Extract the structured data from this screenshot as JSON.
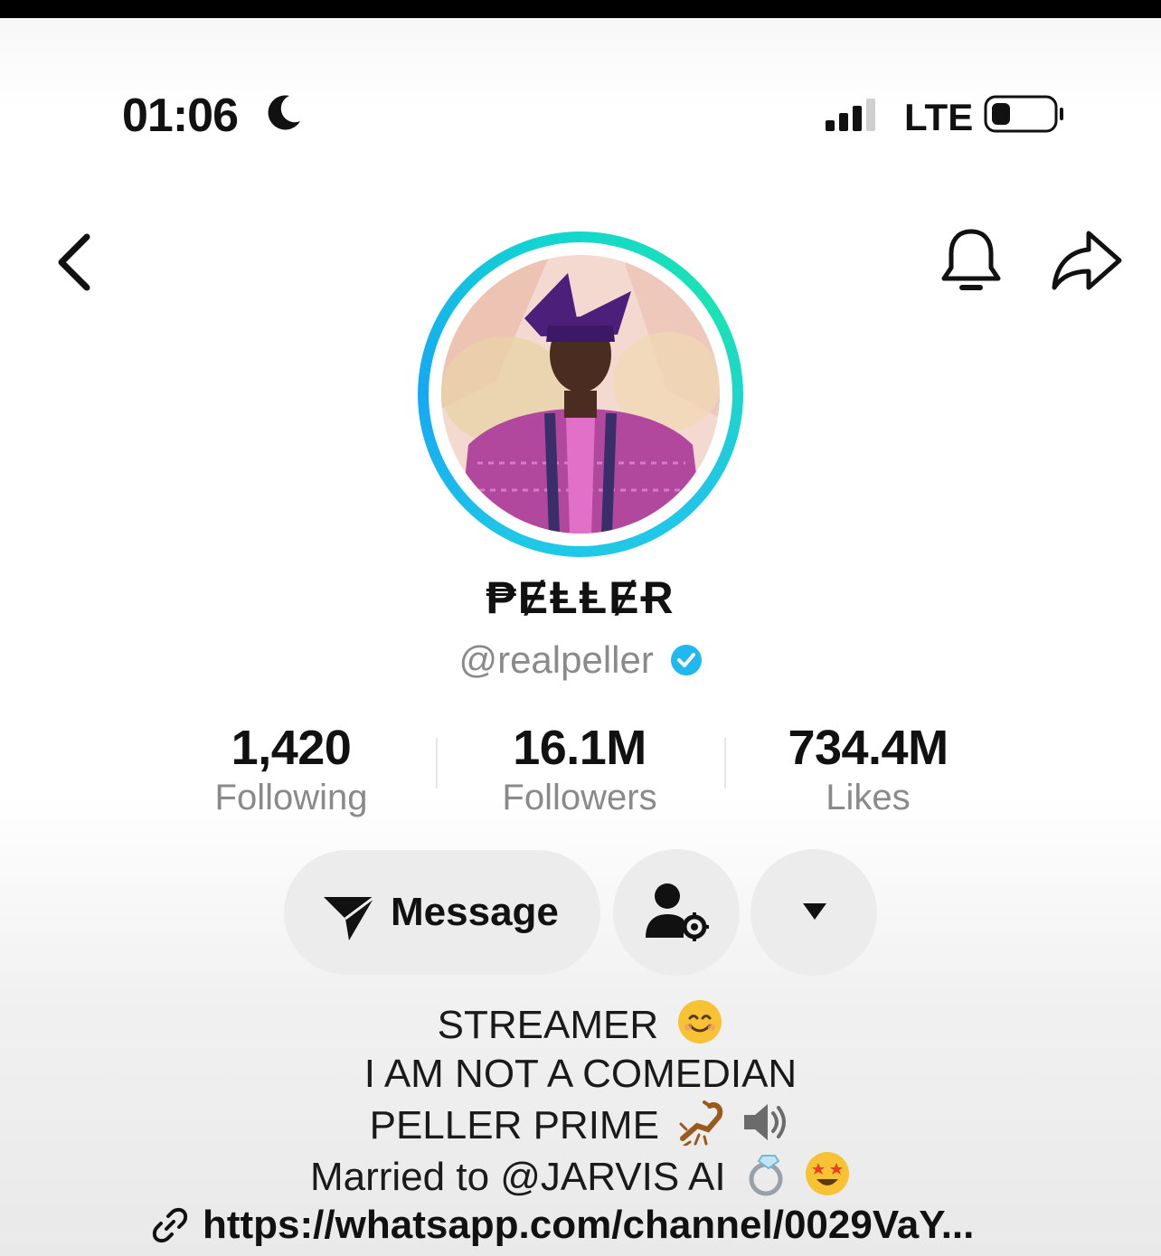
{
  "status_bar": {
    "time": "01:06",
    "network": "LTE"
  },
  "profile": {
    "display_name": "₱ɆⱠⱠɆɌ",
    "handle": "@realpeller",
    "verified": true
  },
  "stats": [
    {
      "value": "1,420",
      "label": "Following"
    },
    {
      "value": "16.1M",
      "label": "Followers"
    },
    {
      "value": "734.4M",
      "label": "Likes"
    }
  ],
  "actions": {
    "message_label": "Message"
  },
  "bio": {
    "line1": "STREAMER",
    "line2": "I AM NOT A COMEDIAN",
    "line3": "PELLER PRIME",
    "line4": "Married to @JARVIS AI",
    "link": "https://whatsapp.com/channel/0029VaY..."
  },
  "icons": {
    "status": [
      "moon-icon",
      "signal-icon",
      "battery-icon"
    ],
    "nav": [
      "back-icon",
      "bell-icon",
      "share-icon"
    ],
    "actions": [
      "send-icon",
      "user-settings-icon",
      "chevron-down-icon"
    ],
    "bio": [
      "smile-emoji-icon",
      "scorpion-emoji-icon",
      "speaker-emoji-icon",
      "ring-emoji-icon",
      "star-struck-emoji-icon",
      "link-icon"
    ]
  },
  "colors": {
    "ring_gradient": [
      "#15a8f3",
      "#1be3b2"
    ],
    "verified_badge": "#20b8f0",
    "button_bg": "#ececec",
    "secondary_text": "#8a8a8a"
  }
}
